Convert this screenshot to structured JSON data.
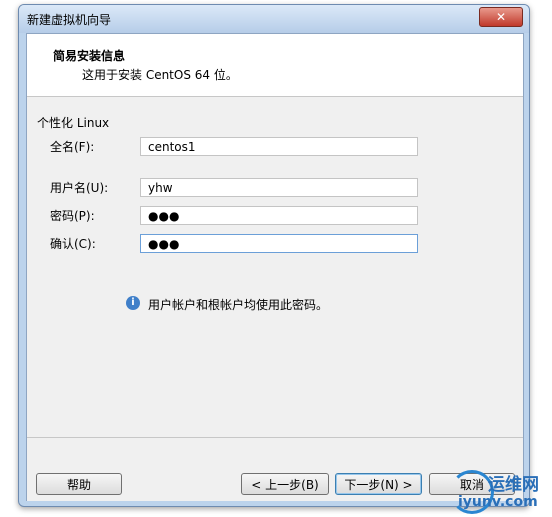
{
  "window": {
    "title": "新建虚拟机向导",
    "close_label": "✕"
  },
  "header": {
    "title": "简易安装信息",
    "subtitle": "这用于安装 CentOS 64 位。"
  },
  "section": {
    "label": "个性化 Linux"
  },
  "fields": {
    "fullname": {
      "label": "全名(F):",
      "value": "centos1"
    },
    "username": {
      "label": "用户名(U):",
      "value": "yhw"
    },
    "password": {
      "label": "密码(P):",
      "value": "●●●"
    },
    "confirm": {
      "label": "确认(C):",
      "value": "●●●"
    }
  },
  "info": {
    "icon": "info-icon",
    "glyph": "i",
    "text": "用户帐户和根帐户均使用此密码。"
  },
  "buttons": {
    "help": "帮助",
    "back": "< 上一步(B)",
    "next": "下一步(N) >",
    "cancel": "取消"
  },
  "watermark": {
    "line1": "运维网",
    "line2": "iyunv.com"
  }
}
